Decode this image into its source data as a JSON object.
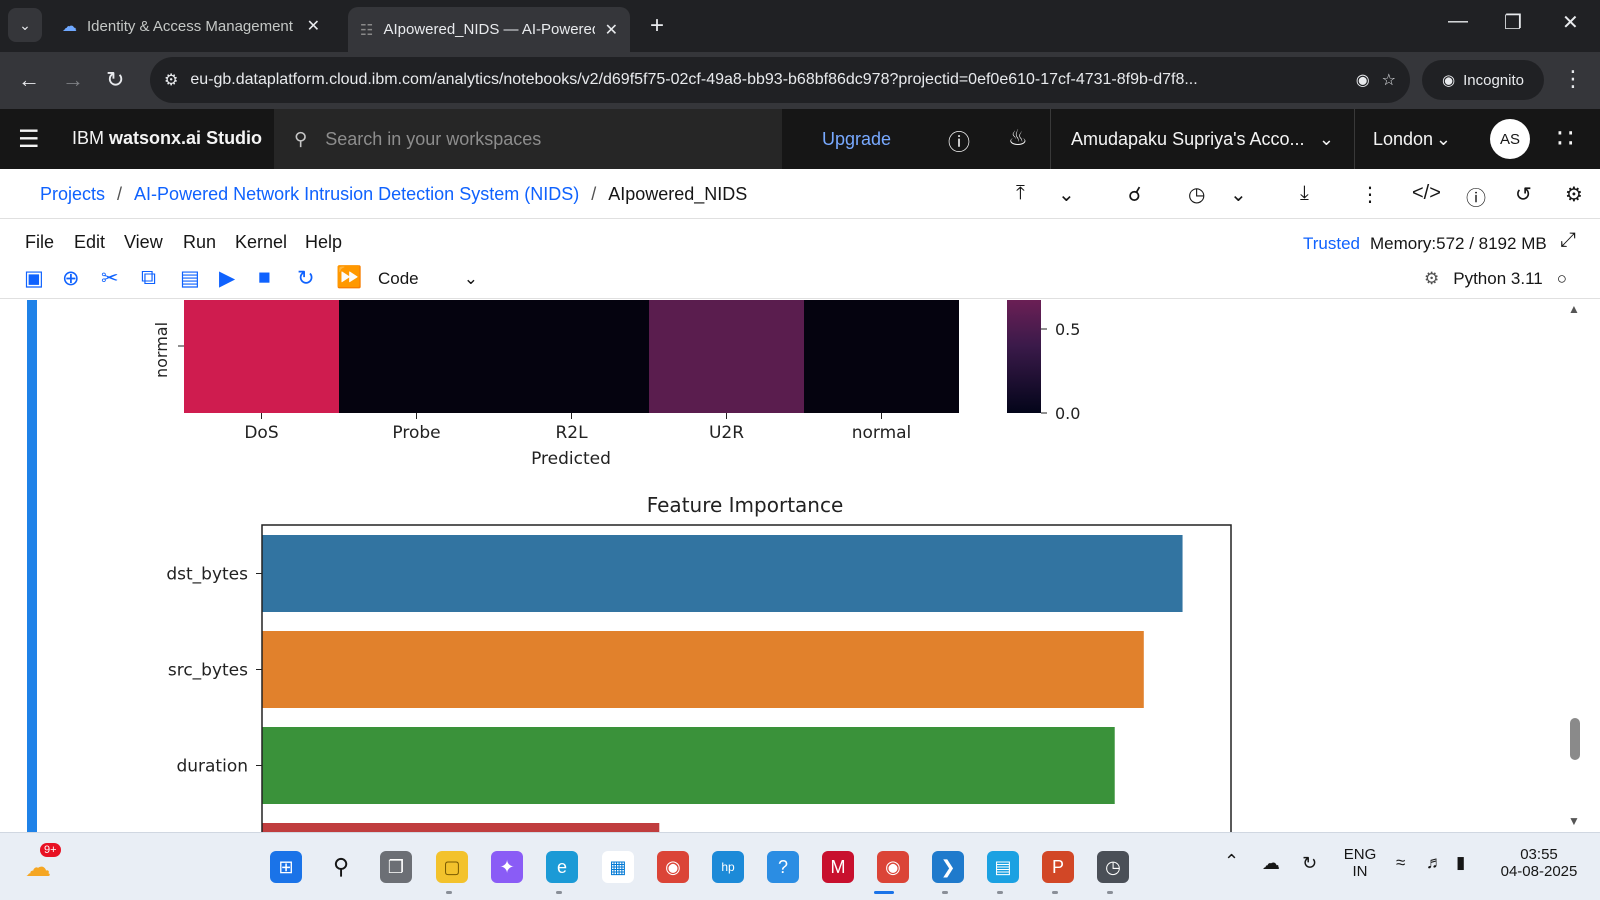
{
  "browser": {
    "tabs": [
      {
        "title": "Identity & Access Management",
        "active": false
      },
      {
        "title": "AIpowered_NIDS — AI-Powered",
        "active": true
      }
    ],
    "url": "eu-gb.dataplatform.cloud.ibm.com/analytics/notebooks/v2/d69f5f75-02cf-49a8-bb93-b68bf86dc978?projectid=0ef0e610-17cf-4731-8f9b-d7f8...",
    "incognito_label": "Incognito"
  },
  "ibm_header": {
    "brand_prefix": "IBM",
    "brand_product": "watsonx.ai Studio",
    "search_placeholder": "Search in your workspaces",
    "upgrade_label": "Upgrade",
    "account": "Amudapaku Supriya's Acco...",
    "region": "London",
    "avatar_initials": "AS"
  },
  "breadcrumb": {
    "projects": "Projects",
    "project": "AI-Powered Network Intrusion Detection System (NIDS)",
    "notebook": "AIpowered_NIDS"
  },
  "menu": {
    "items": [
      "File",
      "Edit",
      "View",
      "Run",
      "Kernel",
      "Help"
    ],
    "trusted": "Trusted",
    "memory": "Memory:572 / 8192 MB"
  },
  "toolbar": {
    "cell_type": "Code",
    "kernel": "Python 3.11"
  },
  "chart_data": [
    {
      "type": "heatmap",
      "note": "partially visible confusion matrix (bottom row only)",
      "visible_row_label": "normal",
      "x_categories": [
        "DoS",
        "Probe",
        "R2L",
        "U2R",
        "normal"
      ],
      "xlabel": "Predicted",
      "row_colors": [
        "#cf1c4f",
        "#05030f",
        "#05030f",
        "#5a1d4e",
        "#05030f"
      ],
      "colorbar_ticks": [
        "0.5",
        "0.0"
      ]
    },
    {
      "type": "bar",
      "orientation": "horizontal",
      "title": "Feature Importance",
      "categories": [
        "dst_bytes",
        "src_bytes",
        "duration"
      ],
      "values": [
        0.95,
        0.91,
        0.88
      ],
      "partial_fourth_bar_value": 0.41,
      "colors": [
        "#3274a1",
        "#e1812c",
        "#3a923a",
        "#c03d3e"
      ],
      "xlim": [
        0,
        1.0
      ]
    }
  ],
  "taskbar": {
    "weather_badge": "9+",
    "language_line1": "ENG",
    "language_line2": "IN",
    "time": "03:55",
    "date": "04-08-2025"
  }
}
